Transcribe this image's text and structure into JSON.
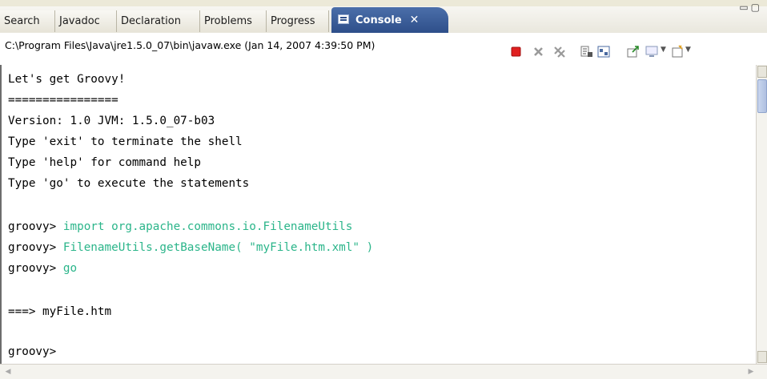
{
  "tabs": [
    {
      "label": "Search"
    },
    {
      "label": "Javadoc"
    },
    {
      "label": "Declaration"
    },
    {
      "label": "Problems"
    },
    {
      "label": "Progress"
    },
    {
      "label": "Console",
      "active": true
    }
  ],
  "process_path": "C:\\Program Files\\Java\\jre1.5.0_07\\bin\\javaw.exe (Jan 14, 2007 4:39:50 PM)",
  "console": {
    "lines": [
      "Let's get Groovy!",
      "================",
      "Version: 1.0 JVM: 1.5.0_07-b03",
      "Type 'exit' to terminate the shell",
      "Type 'help' for command help",
      "Type 'go' to execute the statements",
      "",
      {
        "prompt": "groovy> ",
        "input": "import org.apache.commons.io.FilenameUtils"
      },
      {
        "prompt": "groovy> ",
        "input": "FilenameUtils.getBaseName( \"myFile.htm.xml\" )"
      },
      {
        "prompt": "groovy> ",
        "input": "go"
      },
      "",
      "===> myFile.htm",
      "",
      {
        "prompt": "groovy>",
        "input": ""
      }
    ]
  },
  "colors": {
    "active_tab": "#2e4f8a",
    "input_text": "#2bb58a",
    "terminate": "#e02020"
  },
  "toolbar_icons": [
    "terminate-icon",
    "remove-launch-icon",
    "remove-all-terminated-icon",
    "scroll-lock-icon",
    "show-console-on-output-icon",
    "pin-console-icon",
    "display-selected-console-icon",
    "open-console-icon"
  ]
}
